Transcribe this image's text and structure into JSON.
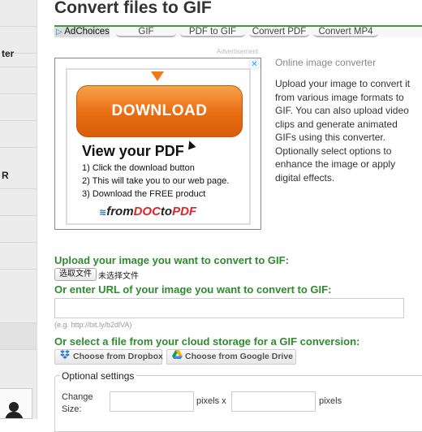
{
  "sidebar": {
    "items": [
      {
        "label": ""
      },
      {
        "label": ""
      },
      {
        "label": "ter"
      },
      {
        "label": ""
      },
      {
        "label": ""
      },
      {
        "label": ""
      },
      {
        "label": "R"
      },
      {
        "label": ""
      },
      {
        "label": ""
      },
      {
        "label": ""
      },
      {
        "label": ""
      },
      {
        "label": ""
      }
    ]
  },
  "page": {
    "title": "Convert files to GIF"
  },
  "adbar": {
    "adchoices": "AdChoices",
    "links": [
      "GIF",
      "PDF to GIF",
      "Convert PDF",
      "Convert MP4"
    ]
  },
  "ad": {
    "caption": "Advertisement",
    "close_icon": "close-x-icon",
    "download_label": "DOWNLOAD",
    "headline": "View your PDF",
    "steps": [
      "1) Click the download button",
      "2) This will take you to our web page.",
      "3) Download the FREE product"
    ],
    "logo_prefix": "from",
    "logo_highlight": "DOC",
    "logo_mid": "to",
    "logo_suffix": "PDF"
  },
  "description": {
    "title": "Online image converter",
    "body": "Upload your image to convert it from various image formats to GIF. You can also upload video clips and generate animated GIFs using this converter. Optionally select options to enhance the image or apply digital effects."
  },
  "upload": {
    "title": "Upload your image you want to convert to GIF:",
    "file_button": "选取文件",
    "file_status": "未选择文件"
  },
  "url": {
    "title": "Or enter URL of your image you want to convert to GIF:",
    "value": "",
    "hint": "(e.g. http://bit.ly/b2dlVA)"
  },
  "cloud": {
    "title": "Or select a file from your cloud storage for a GIF conversion:",
    "dropbox_label": "Choose from Dropbox",
    "gdrive_label": "Choose from Google Drive",
    "dropbox_color": "#2f7fd6",
    "gdrive_colors": [
      "#f4b400",
      "#0f9d58",
      "#4285f4"
    ]
  },
  "options": {
    "legend": "Optional settings",
    "change_size_label": "Change Size:",
    "pixels_x": "pixels x",
    "pixels": "pixels",
    "width_value": "",
    "height_value": ""
  },
  "colors": {
    "accent_green": "#2e8b2e",
    "download_orange": "#e86c12"
  }
}
